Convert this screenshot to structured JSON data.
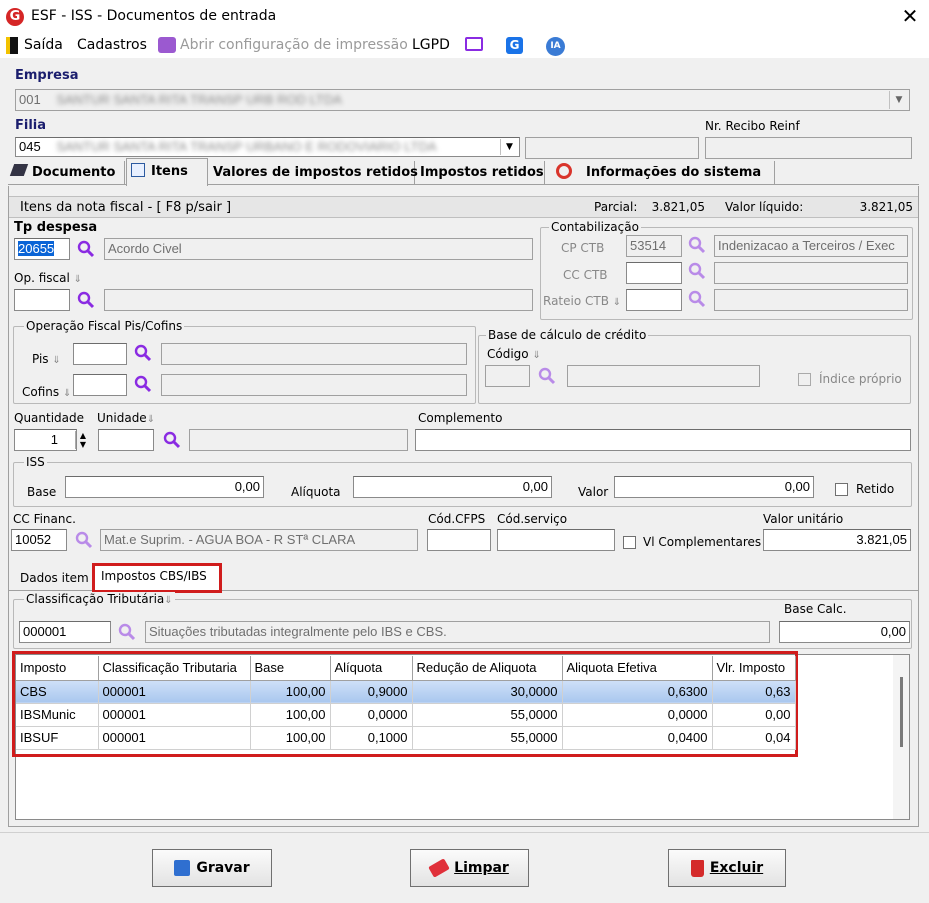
{
  "window": {
    "title": "ESF - ISS - Documentos de entrada",
    "app_icon": "G"
  },
  "toolbar": {
    "saida": "Saída",
    "cadastros": "Cadastros",
    "print": "Abrir configuração de impressão",
    "lgpd": "LGPD",
    "ia": "IA"
  },
  "empresa": {
    "label": "Empresa",
    "code": "001",
    "name": "SANTUR SANTA RITA TRANSP URB ROD LTDA"
  },
  "filial": {
    "label": "Filial",
    "code": "045",
    "name": "SANTUR SANTA RITA TRANSP URBANO E RODOVIARIO LTDA"
  },
  "recibo": {
    "label": "Nr. Recibo Reinf",
    "value": ""
  },
  "tabs": [
    "Documento",
    "Itens",
    "Valores de impostos retidos",
    "Impostos retidos",
    "Informações do sistema"
  ],
  "itens": {
    "header": "Itens da nota fiscal - [ F8 p/sair ]",
    "parcial_label": "Parcial:",
    "parcial": "3.821,05",
    "liquido_label": "Valor líquido:",
    "liquido": "3.821,05"
  },
  "despesa": {
    "label": "Tp despesa",
    "code": "20655",
    "desc": "Acordo Civel"
  },
  "opfiscal": {
    "label": "Op. fiscal",
    "code": "",
    "desc": ""
  },
  "contab": {
    "title": "Contabilização",
    "cp_label": "CP CTB",
    "cp_code": "53514",
    "cp_desc": "Indenizacao a Terceiros / Exec",
    "cc_label": "CC CTB",
    "rateio_label": "Rateio CTB"
  },
  "pis_cofins": {
    "title": "Operação Fiscal Pis/Cofins",
    "pis": "Pis",
    "cofins": "Cofins"
  },
  "base_credito": {
    "title": "Base de cálculo de crédito",
    "codigo": "Código",
    "indice": "Índice próprio"
  },
  "quantidade": {
    "label": "Quantidade",
    "value": "1",
    "unidade_label": "Unidade",
    "complemento_label": "Complemento"
  },
  "iss": {
    "title": "ISS",
    "base_label": "Base",
    "base": "0,00",
    "aliquota_label": "Alíquota",
    "aliquota": "0,00",
    "valor_label": "Valor",
    "valor": "0,00",
    "retido": "Retido"
  },
  "cc": {
    "label": "CC Financ.",
    "code": "10052",
    "desc": "Mat.e Suprim. - AGUA BOA - R STª CLARA",
    "cfps_label": "Cód.CFPS",
    "servico_label": "Cód.serviço",
    "vl_comp": "Vl Complementares",
    "unit_label": "Valor unitário",
    "unit": "3.821,05"
  },
  "subtabs": [
    "Dados item",
    "Impostos CBS/IBS"
  ],
  "classif": {
    "title": "Classificação Tributária",
    "code": "000001",
    "desc": "Situações tributadas integralmente pelo IBS e CBS.",
    "base_label": "Base Calc.",
    "base": "0,00"
  },
  "table": {
    "columns": [
      "Imposto",
      "Classificação Tributaria",
      "Base",
      "Alíquota",
      "Redução de Aliquota",
      "Aliquota Efetiva",
      "Vlr. Imposto"
    ],
    "rows": [
      [
        "CBS",
        "000001",
        "100,00",
        "0,9000",
        "30,0000",
        "0,6300",
        "0,63"
      ],
      [
        "IBSMunic",
        "000001",
        "100,00",
        "0,0000",
        "55,0000",
        "0,0000",
        "0,00"
      ],
      [
        "IBSUF",
        "000001",
        "100,00",
        "0,1000",
        "55,0000",
        "0,0400",
        "0,04"
      ]
    ]
  },
  "buttons": {
    "gravar": "Gravar",
    "limpar": "Limpar",
    "excluir": "Excluir"
  },
  "colors": {
    "accent": "#8a2be2",
    "highlight": "#d01c1c",
    "selected": "#a9c7ee"
  }
}
